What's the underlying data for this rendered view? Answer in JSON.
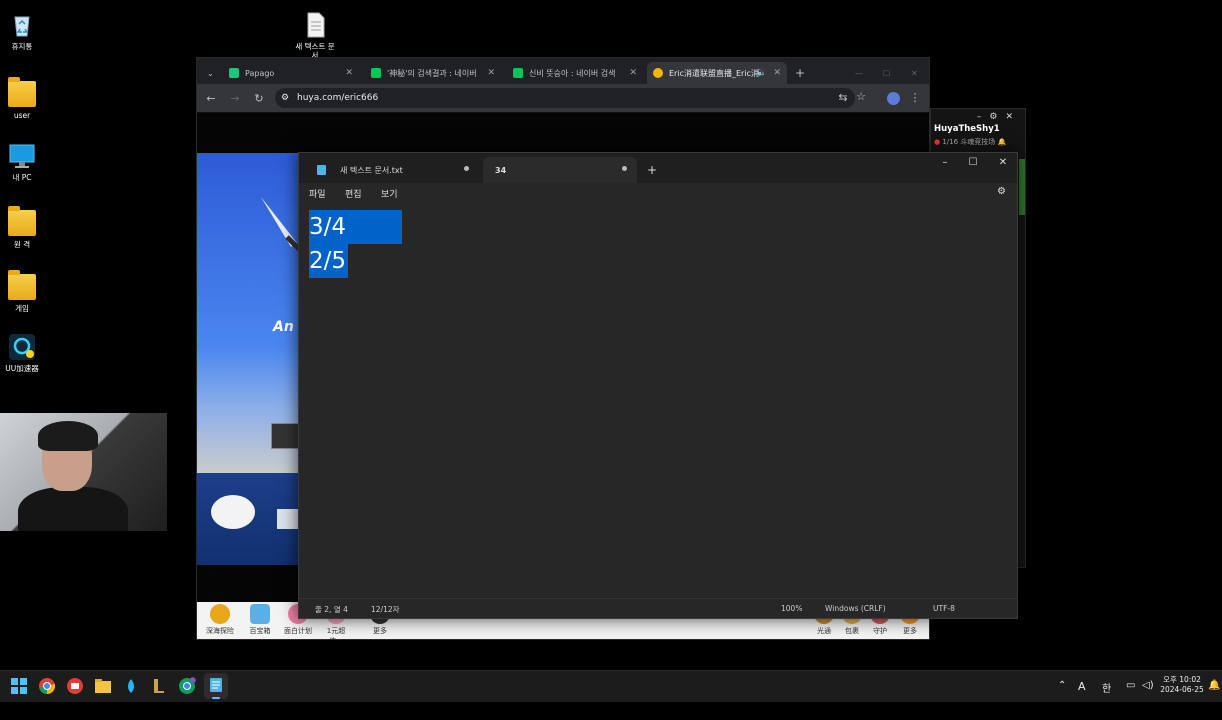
{
  "desktop": {
    "icons": [
      {
        "label": "휴지통",
        "icon": "recycle-bin-icon"
      },
      {
        "label": "새 텍스트 문서",
        "icon": "text-file-icon"
      },
      {
        "label": "user",
        "icon": "folder-icon"
      },
      {
        "label": "내 PC",
        "icon": "monitor-icon"
      },
      {
        "label": "원 격",
        "icon": "folder-icon"
      },
      {
        "label": "게임",
        "icon": "game-folder-icon"
      },
      {
        "label": "UU加速器",
        "icon": "uu-accelerator-icon"
      }
    ]
  },
  "browser": {
    "tabs": [
      {
        "label": "Papago",
        "color": "#1fc37b"
      },
      {
        "label": "'神秘'의 검색결과 : 네이버",
        "color": "#03c75a"
      },
      {
        "label": "신비 뜻승아 : 네이버 검색",
        "color": "#03c75a"
      },
      {
        "label": "Eric消遣联盟直播_Eric消",
        "color": "#f4b400"
      }
    ],
    "url": "huya.com/eric666",
    "page": {
      "banner_text": "An",
      "game_items": [
        "深海探险",
        "百宝箱",
        "面白计划",
        "1元超值...",
        "更多",
        "光通",
        "包裹",
        "守护",
        "更多"
      ]
    }
  },
  "sidechat": {
    "username": "HuyaTheShy1",
    "sub": "1/16 斗魂竞技场"
  },
  "notepad": {
    "tabs": [
      {
        "label": "새 텍스트 문서.txt"
      },
      {
        "label": "34"
      }
    ],
    "menu": [
      "파일",
      "편집",
      "보기"
    ],
    "lines": [
      "3/4",
      "2/5"
    ],
    "status": {
      "position": "줄 2, 열 4",
      "chars": "12/12자",
      "zoom": "100%",
      "line_ending": "Windows (CRLF)",
      "encoding": "UTF-8"
    }
  },
  "taskbar": {
    "tray": {
      "ime_a": "A",
      "ime_han": "한",
      "time": "오후 10:02",
      "date": "2024-06-25"
    }
  }
}
